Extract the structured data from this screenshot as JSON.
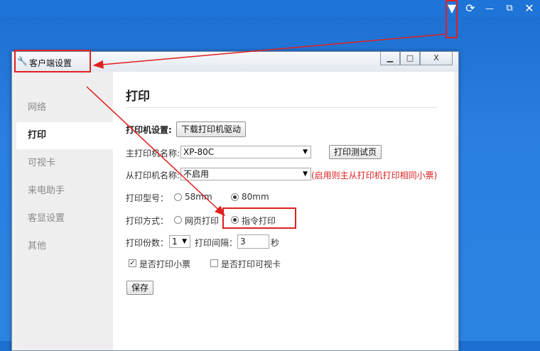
{
  "topbar": {
    "menu_glyph": "▼",
    "refresh_glyph": "⟳",
    "minimize_glyph": "—",
    "restore_glyph": "⧉",
    "close_glyph": "✕"
  },
  "dialog": {
    "title": "客户端设置",
    "icon": "wrench-icon",
    "min_glyph": "▁",
    "max_glyph": "□",
    "close_glyph": "X"
  },
  "sidebar": {
    "items": [
      {
        "label": "网络",
        "active": false
      },
      {
        "label": "打印",
        "active": true
      },
      {
        "label": "可视卡",
        "active": false
      },
      {
        "label": "来电助手",
        "active": false
      },
      {
        "label": "客显设置",
        "active": false
      },
      {
        "label": "其他",
        "active": false
      }
    ]
  },
  "print": {
    "heading": "打印",
    "printer_settings_label": "打印机设置:",
    "download_driver_button": "下载打印机驱动",
    "main_printer_label": "主打印机名称:",
    "main_printer_value": "XP-80C",
    "test_page_button": "打印测试页",
    "secondary_printer_label": "从打印机名称:",
    "secondary_printer_value": "不启用",
    "secondary_hint": "(启用则主从打印机打印相同小票)",
    "model_label": "打印型号：",
    "model_options": [
      "58mm",
      "80mm"
    ],
    "model_selected": "80mm",
    "mode_label": "打印方式：",
    "mode_options": [
      "网页打印",
      "指令打印"
    ],
    "mode_selected": "指令打印",
    "copies_label": "打印份数：",
    "copies_value": "1",
    "interval_label": "打印间隔：",
    "interval_value": "3",
    "interval_unit": "秒",
    "print_receipt_label": "是否打印小票",
    "print_receipt_checked": true,
    "print_visual_card_label": "是否打印可视卡",
    "print_visual_card_checked": false,
    "save_button": "保存"
  },
  "colors": {
    "annotation": "#e02020",
    "desktop": "#2a7fe0",
    "hint_text": "#dd2222"
  }
}
